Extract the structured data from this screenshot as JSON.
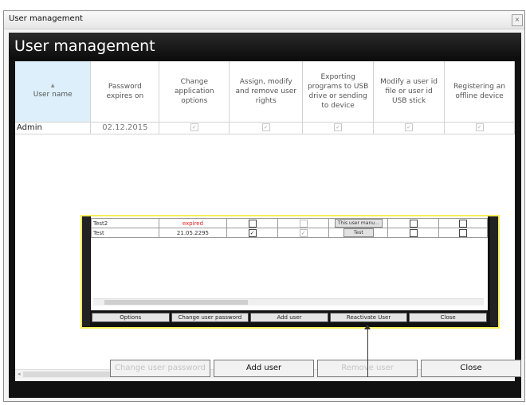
{
  "window": {
    "title": "User management",
    "close_icon": "×"
  },
  "header": {
    "title": "User management"
  },
  "table": {
    "columns": [
      "User name",
      "Password expires on",
      "Change application options",
      "Assign, modify and remove user rights",
      "Exporting programs to USB drive or sending to device",
      "Modify a user id file or user id USB stick",
      "Registering an offline device"
    ],
    "rows": [
      {
        "name": "Admin",
        "expires": "02.12.2015",
        "perms": [
          true,
          true,
          true,
          true,
          true
        ]
      }
    ]
  },
  "inset": {
    "rows": [
      {
        "name": "Test2",
        "expires": "expired",
        "c1": false,
        "c2": false,
        "btn": "This user manu...",
        "c3": false,
        "c4": false
      },
      {
        "name": "Test",
        "expires": "21.05.2295",
        "c1": true,
        "c2": true,
        "btn": "Test",
        "c3": false,
        "c4": false
      }
    ],
    "buttons": [
      "Options",
      "Change user password",
      "Add user",
      "Reactivate User",
      "Close"
    ]
  },
  "buttons": {
    "change_password": "Change user password",
    "add_user": "Add user",
    "remove_user": "Remove user",
    "close": "Close"
  },
  "scroll": {
    "left": "◂",
    "right": "▸",
    "grip": "≡"
  },
  "colors": {
    "expired": "#e02020",
    "highlight": "#f5ee5a",
    "header_selected": "#dceffa"
  }
}
